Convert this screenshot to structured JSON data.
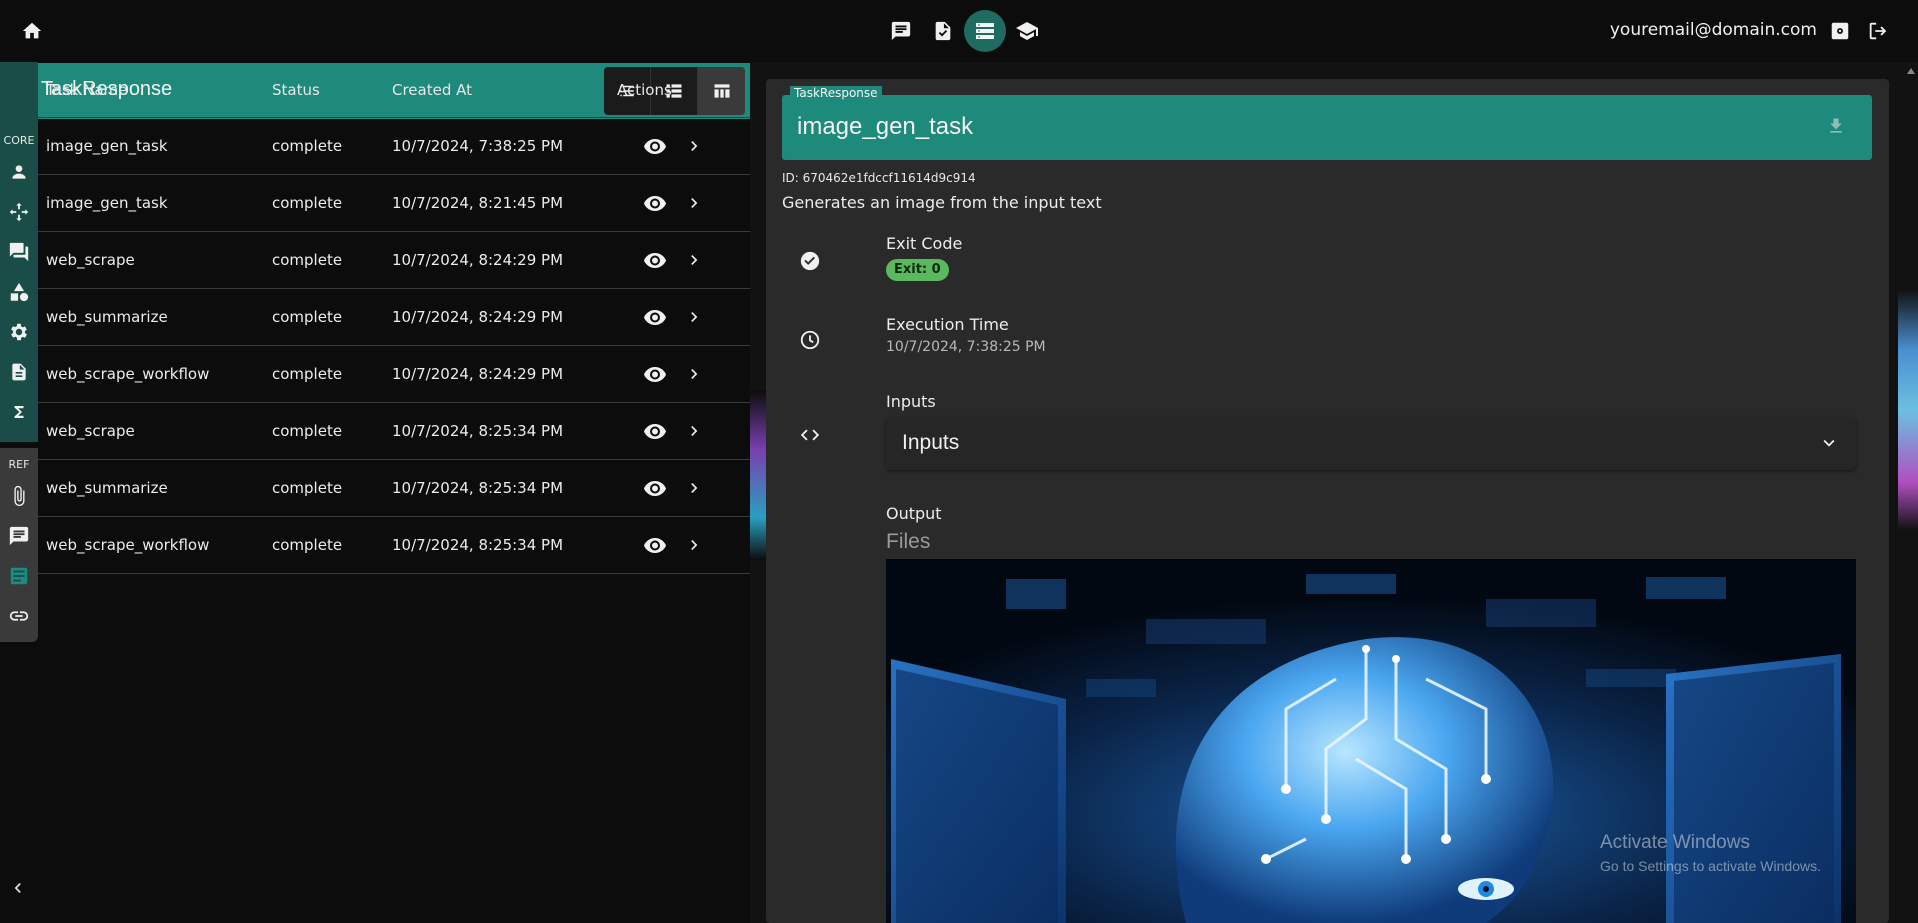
{
  "header": {
    "email": "youremail@domain.com",
    "nav": [
      "chat-icon",
      "task-check-icon",
      "list-icon",
      "school-icon"
    ],
    "active_nav": 2
  },
  "left_panel": {
    "title": "TaskResponse",
    "views": [
      "list-icon",
      "detail-list-icon",
      "table-icon"
    ],
    "active_view": 2,
    "rail": {
      "core_label": "CORE",
      "ref_label": "REF",
      "core_icons": [
        "person-icon",
        "move-icon",
        "forum-icon",
        "shapes-icon",
        "settings-icon",
        "document-icon",
        "sigma-icon"
      ],
      "ref_icons": [
        "attach-icon",
        "chat-icon",
        "task-response-icon",
        "link-icon"
      ]
    },
    "table": {
      "headers": [
        "Task Name",
        "Status",
        "Created At",
        "Actions"
      ],
      "rows": [
        {
          "name": "image_gen_task",
          "status": "complete",
          "created": "10/7/2024, 7:38:25 PM"
        },
        {
          "name": "image_gen_task",
          "status": "complete",
          "created": "10/7/2024, 8:21:45 PM"
        },
        {
          "name": "web_scrape",
          "status": "complete",
          "created": "10/7/2024, 8:24:29 PM"
        },
        {
          "name": "web_summarize",
          "status": "complete",
          "created": "10/7/2024, 8:24:29 PM"
        },
        {
          "name": "web_scrape_workflow",
          "status": "complete",
          "created": "10/7/2024, 8:24:29 PM"
        },
        {
          "name": "web_scrape",
          "status": "complete",
          "created": "10/7/2024, 8:25:34 PM"
        },
        {
          "name": "web_summarize",
          "status": "complete",
          "created": "10/7/2024, 8:25:34 PM"
        },
        {
          "name": "web_scrape_workflow",
          "status": "complete",
          "created": "10/7/2024, 8:25:34 PM"
        }
      ]
    }
  },
  "detail": {
    "legend": "TaskResponse",
    "name": "image_gen_task",
    "id_text": "ID: 670462e1fdccf11614d9c914",
    "description": "Generates an image from the input text",
    "exit_code_label": "Exit Code",
    "exit_badge": "Exit: 0",
    "execution_time_label": "Execution Time",
    "execution_time": "10/7/2024, 7:38:25 PM",
    "inputs_label": "Inputs",
    "inputs_accordion": "Inputs",
    "output_label": "Output",
    "files_label": "Files"
  },
  "watermark": {
    "line1": "Activate Windows",
    "line2": "Go to Settings to activate Windows."
  },
  "colors": {
    "accent": "#1e8a7c",
    "success": "#5bb85f",
    "background": "#0c0c0c",
    "card": "#2a2a2a"
  }
}
